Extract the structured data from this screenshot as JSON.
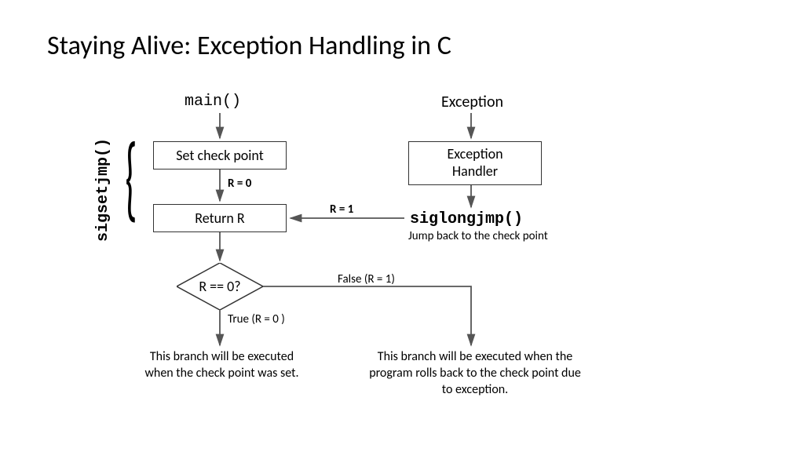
{
  "title": "Staying Alive: Exception Handling in C",
  "labels": {
    "main": "main()",
    "exception": "Exception",
    "sigsetjmp": "sigsetjmp()",
    "siglongjmp": "siglongjmp()",
    "jump_back": "Jump back to the check point"
  },
  "boxes": {
    "set_check": "Set check point",
    "return_r": "Return R",
    "handler": "Exception\nHandler"
  },
  "edges": {
    "r0": "R = 0",
    "r1": "R = 1",
    "cond": "R == 0?",
    "true": "True (R = 0 )",
    "false": "False (R = 1)"
  },
  "notes": {
    "left_branch": "This branch will be\nexecuted when the\ncheck point was set.",
    "right_branch": "This branch will be executed\nwhen the program rolls back to\nthe check point due to exception."
  },
  "chart_data": {
    "type": "flowchart",
    "nodes": [
      {
        "id": "main",
        "text": "main()",
        "shape": "text"
      },
      {
        "id": "setcp",
        "text": "Set check point",
        "shape": "rect"
      },
      {
        "id": "ret",
        "text": "Return R",
        "shape": "rect"
      },
      {
        "id": "cond",
        "text": "R == 0?",
        "shape": "diamond"
      },
      {
        "id": "exc",
        "text": "Exception",
        "shape": "text"
      },
      {
        "id": "handler",
        "text": "Exception Handler",
        "shape": "rect"
      },
      {
        "id": "siglong",
        "text": "siglongjmp()",
        "shape": "text",
        "annotation": "Jump back to the check point"
      },
      {
        "id": "leaf_true",
        "text": "This branch will be executed when the check point was set.",
        "shape": "text"
      },
      {
        "id": "leaf_false",
        "text": "This branch will be executed when the program rolls back to the check point due to exception.",
        "shape": "text"
      }
    ],
    "edges": [
      {
        "from": "main",
        "to": "setcp"
      },
      {
        "from": "setcp",
        "to": "ret",
        "label": "R = 0"
      },
      {
        "from": "ret",
        "to": "cond"
      },
      {
        "from": "cond",
        "to": "leaf_true",
        "label": "True (R = 0 )"
      },
      {
        "from": "cond",
        "to": "leaf_false",
        "label": "False (R = 1)"
      },
      {
        "from": "exc",
        "to": "handler"
      },
      {
        "from": "handler",
        "to": "siglong"
      },
      {
        "from": "siglong",
        "to": "ret",
        "label": "R = 1"
      }
    ],
    "group": {
      "label": "sigsetjmp()",
      "members": [
        "setcp",
        "ret"
      ]
    }
  }
}
